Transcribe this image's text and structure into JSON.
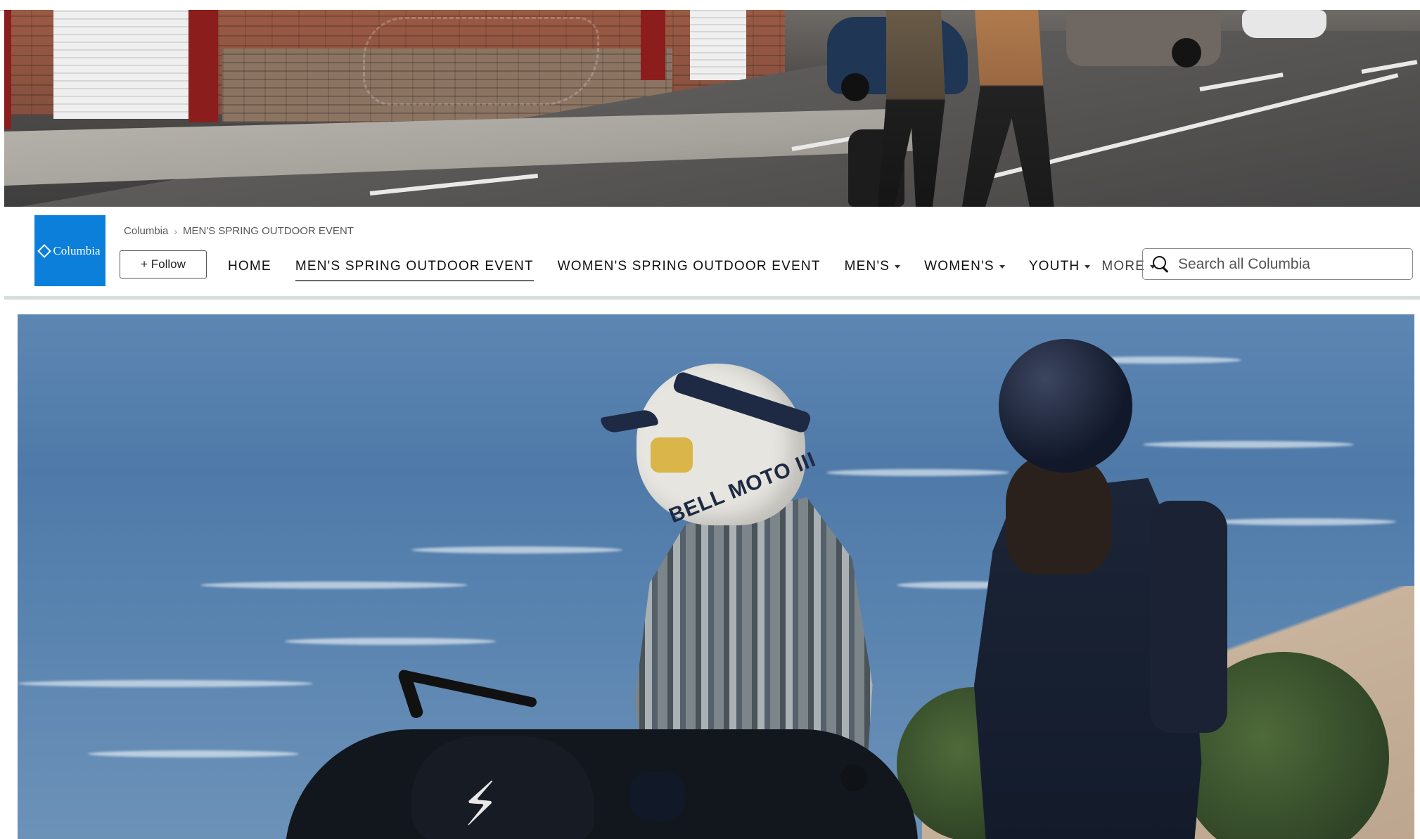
{
  "breadcrumb": {
    "root": "Columbia",
    "current": "MEN'S SPRING OUTDOOR EVENT"
  },
  "logo": {
    "text": "Columbia",
    "icon": "columbia-diamond-icon",
    "bg_color": "#0b7fd9"
  },
  "follow_button": {
    "label": "+ Follow"
  },
  "nav": {
    "items": [
      {
        "label": "HOME",
        "active": false,
        "dropdown": false
      },
      {
        "label": "MEN'S SPRING OUTDOOR EVENT",
        "active": true,
        "dropdown": false
      },
      {
        "label": "WOMEN'S SPRING OUTDOOR EVENT",
        "active": false,
        "dropdown": false
      },
      {
        "label": "MEN'S",
        "active": false,
        "dropdown": true
      },
      {
        "label": "WOMEN'S",
        "active": false,
        "dropdown": true
      },
      {
        "label": "YOUTH",
        "active": false,
        "dropdown": true
      }
    ],
    "more_label": "MORE"
  },
  "search": {
    "placeholder": "Search all Columbia",
    "value": "",
    "icon": "search-icon"
  },
  "banner": {
    "helmet_text": "BELL MOTO III",
    "bolt_icon": "lightning-bolt-icon"
  }
}
